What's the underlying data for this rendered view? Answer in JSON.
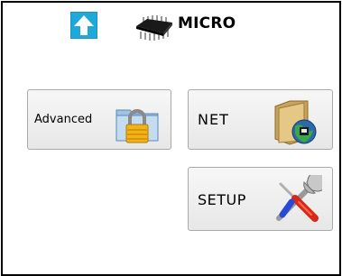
{
  "header": {
    "title": "MICRO",
    "up_icon": "up-arrow-icon",
    "chip_icon": "microchip-icon"
  },
  "buttons": [
    {
      "id": "advanced",
      "label": "Advanced",
      "icon": "padlock-folder-icon"
    },
    {
      "id": "net",
      "label": "NET",
      "icon": "network-folder-icon"
    },
    {
      "id": "setup",
      "label": "SETUP",
      "icon": "tools-icon"
    }
  ],
  "colors": {
    "up_arrow_bg": "#1ea9d6",
    "border": "#000000",
    "button_border": "#a9a9a9"
  }
}
